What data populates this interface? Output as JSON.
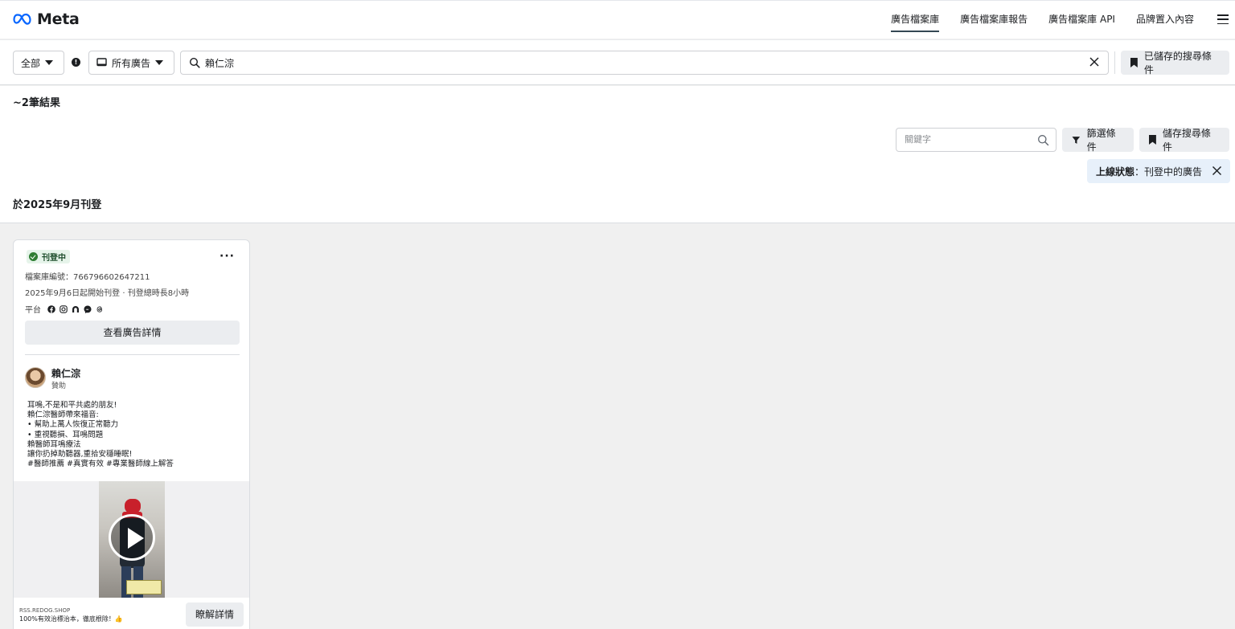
{
  "brand": {
    "name": "Meta",
    "color": "#0866ff"
  },
  "nav": {
    "links": [
      "廣告檔案庫",
      "廣告檔案庫報告",
      "廣告檔案庫 API",
      "品牌置入內容"
    ],
    "active_index": 0
  },
  "search": {
    "country_label": "全部",
    "ad_type_label": "所有廣告",
    "query": "賴仁淙",
    "saved_searches_label": "已儲存的搜尋條件"
  },
  "results": {
    "count_label": "~2筆結果",
    "keyword_placeholder": "關鍵字",
    "filters_label": "篩選條件",
    "save_search_label": "儲存搜尋條件",
    "status_filter_key": "上線狀態",
    "status_filter_sep": "：",
    "status_filter_value": "刊登中的廣告",
    "date_heading": "於2025年9月刊登"
  },
  "ad_card": {
    "status": "刊登中",
    "status_color": "#2e7d32",
    "library_id": "檔案庫編號：766796602647211",
    "run_info": "2025年9月6日起開始刊登 · 刊登總時長8小時",
    "platforms_label": "平台",
    "platform_icons": [
      "facebook-icon",
      "instagram-icon",
      "audience-network-icon",
      "messenger-icon",
      "threads-icon"
    ],
    "details_label": "查看廣告詳情",
    "advertiser": "賴仁淙",
    "sponsored": "贊助",
    "body_lines": [
      "耳鳴,不是和平共處的朋友!",
      "賴仁淙醫師帶來福音:",
      "• 幫助上萬人恢復正常聽力",
      "• 重視聽損、耳鳴問題",
      "賴醫師耳鳴療法",
      "讓你扔掉助聽器,重拾安穩睡眠!",
      "#醫師推薦 #真實有效 #專業醫師線上解答"
    ],
    "link_domain": "RSS.REDOG.SHOP",
    "link_description": "100%有效治標治本，徹底根除！👍",
    "cta_label": "瞭解詳情"
  }
}
